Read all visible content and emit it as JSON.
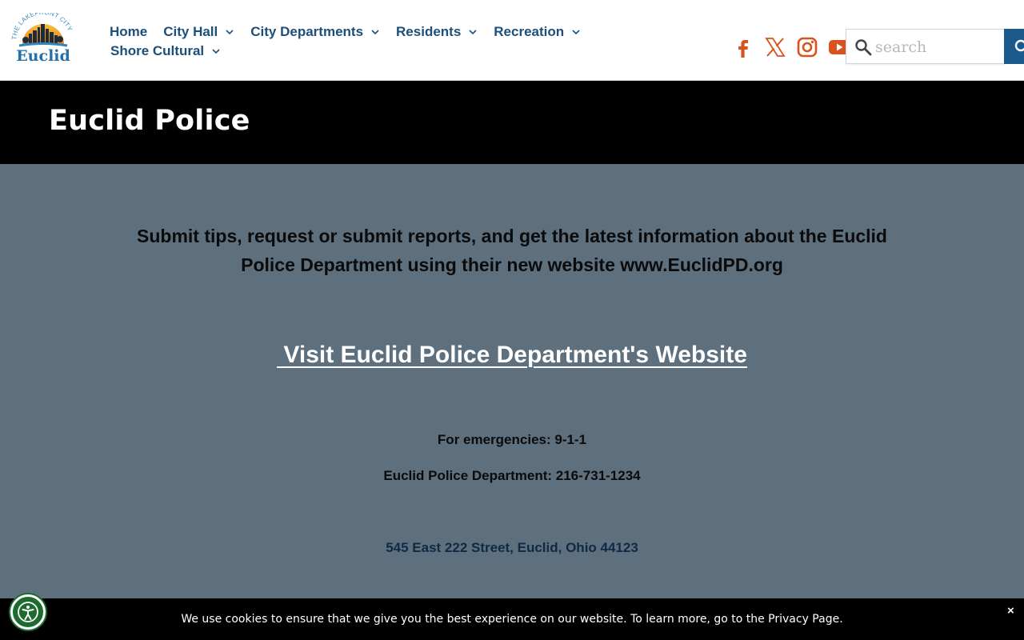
{
  "header": {
    "logo": {
      "arc_text": "THE LAKEFRONT CITY",
      "name": "Euclid"
    },
    "nav": [
      {
        "label": "Home",
        "has_dropdown": false
      },
      {
        "label": "City Hall",
        "has_dropdown": true
      },
      {
        "label": "City Departments",
        "has_dropdown": true
      },
      {
        "label": "Residents",
        "has_dropdown": true
      },
      {
        "label": "Recreation",
        "has_dropdown": true
      },
      {
        "label": "Shore Cultural",
        "has_dropdown": true
      }
    ],
    "social": [
      "facebook-icon",
      "x-twitter-icon",
      "instagram-icon",
      "youtube-icon"
    ],
    "search": {
      "placeholder": "search",
      "value": ""
    }
  },
  "title_band": {
    "title": "Euclid Police"
  },
  "main": {
    "intro": "Submit tips, request or submit reports, and get the latest information about the Euclid Police Department using their new website www.EuclidPD.org",
    "visit_link": " Visit Euclid Police Department's Website",
    "emergency": "For emergencies: 9-1-1",
    "dept_phone": "Euclid Police Department: 216-731-1234",
    "address": "545 East 222 Street, Euclid, Ohio 44123"
  },
  "cookie_bar": {
    "text": "We use cookies to ensure that we give you the best experience on our website. To learn more, go to the Privacy Page.",
    "close_label": "×"
  },
  "colors": {
    "nav_text": "#1b4f7a",
    "social_orange": "#d9531e",
    "title_band": "#000000",
    "main_bg": "#5e6f7d",
    "search_button": "#1b5a8c",
    "accessibility": "#1e6b2f"
  }
}
